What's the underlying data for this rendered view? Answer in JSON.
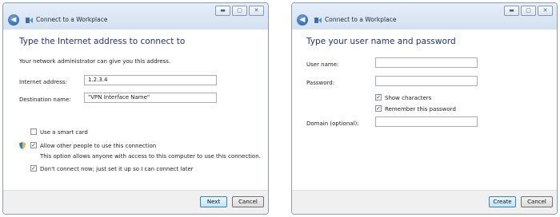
{
  "windows": [
    {
      "title": "Connect to a Workplace",
      "heading": "Type the Internet address to connect to",
      "intro": "Your network administrator can give you this address.",
      "internet_address_label": "Internet address:",
      "internet_address_value": "1.2.3.4",
      "destination_label": "Destination name:",
      "destination_value": "\"VPN Interface Name\"",
      "smart_card_label": "Use a smart card",
      "smart_card_checked": false,
      "allow_others_label": "Allow other people to use this connection",
      "allow_others_checked": true,
      "allow_others_note": "This option allows anyone with access to this computer to use this connection.",
      "dont_connect_label": "Don't connect now; just set it up so I can connect later",
      "dont_connect_checked": true,
      "primary_button": "Next",
      "cancel_button": "Cancel",
      "controls": {
        "minimize": "▬",
        "maximize": "▢",
        "close": "✕"
      }
    },
    {
      "title": "Connect to a Workplace",
      "heading": "Type your user name and password",
      "username_label": "User name:",
      "username_value": "",
      "password_label": "Password:",
      "password_value": "",
      "show_chars_label": "Show characters",
      "show_chars_checked": true,
      "remember_label": "Remember this password",
      "remember_checked": true,
      "domain_label": "Domain (optional):",
      "domain_value": "",
      "primary_button": "Create",
      "cancel_button": "Cancel",
      "controls": {
        "minimize": "▬",
        "maximize": "▢",
        "close": "✕"
      }
    }
  ],
  "icons": {
    "back": "back-arrow-icon",
    "network": "network-icon",
    "shield": "uac-shield-icon"
  },
  "colors": {
    "heading": "#1e3287",
    "header_bg": "#d3e1f1",
    "footer_bg": "#f0f0f0"
  }
}
